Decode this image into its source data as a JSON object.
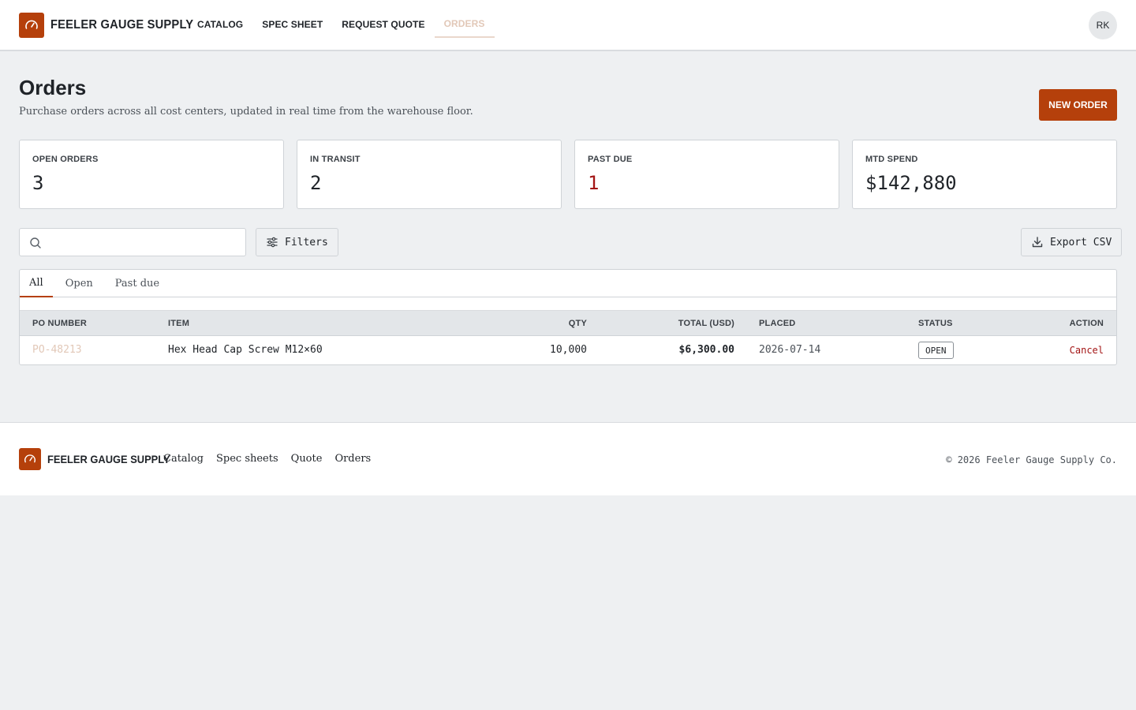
{
  "app": {
    "brand": "FEELER GAUGE SUPPLY",
    "logo_icon": "gauge-icon",
    "accent_color": "#b5400b",
    "danger_color": "#a31515"
  },
  "nav": {
    "items": [
      {
        "label": "CATALOG",
        "active": false
      },
      {
        "label": "SPEC SHEET",
        "active": false
      },
      {
        "label": "REQUEST QUOTE",
        "active": false
      },
      {
        "label": "ORDERS",
        "active": true
      }
    ]
  },
  "user": {
    "initials": "RK"
  },
  "page": {
    "title": "Orders",
    "subtitle": "Purchase orders across all cost centers, updated in real time from the warehouse floor.",
    "new_order_label": "NEW ORDER"
  },
  "stats": [
    {
      "label": "OPEN ORDERS",
      "value": "3"
    },
    {
      "label": "IN TRANSIT",
      "value": "2"
    },
    {
      "label": "PAST DUE",
      "value": "1"
    },
    {
      "label": "MTD SPEND",
      "value": "$142,880"
    }
  ],
  "toolbar": {
    "search_placeholder": "",
    "search_value": "",
    "filters_label": "Filters",
    "export_label": "Export CSV"
  },
  "tabs": [
    {
      "label": "All",
      "active": true
    },
    {
      "label": "Open",
      "active": false
    },
    {
      "label": "Past due",
      "active": false
    }
  ],
  "table": {
    "columns": [
      "PO NUMBER",
      "ITEM",
      "QTY",
      "TOTAL (USD)",
      "PLACED",
      "STATUS",
      "ACTION"
    ],
    "rows": [
      {
        "po": "PO-48213",
        "item": "Hex Head Cap Screw M12×60",
        "qty": "10,000",
        "total": "$6,300.00",
        "placed": "2026-07-14",
        "status": "OPEN",
        "action": "Cancel"
      }
    ]
  },
  "footer": {
    "brand": "FEELER GAUGE SUPPLY",
    "links": [
      "Catalog",
      "Spec sheets",
      "Quote",
      "Orders"
    ],
    "copyright": "© 2026 Feeler Gauge Supply Co."
  }
}
